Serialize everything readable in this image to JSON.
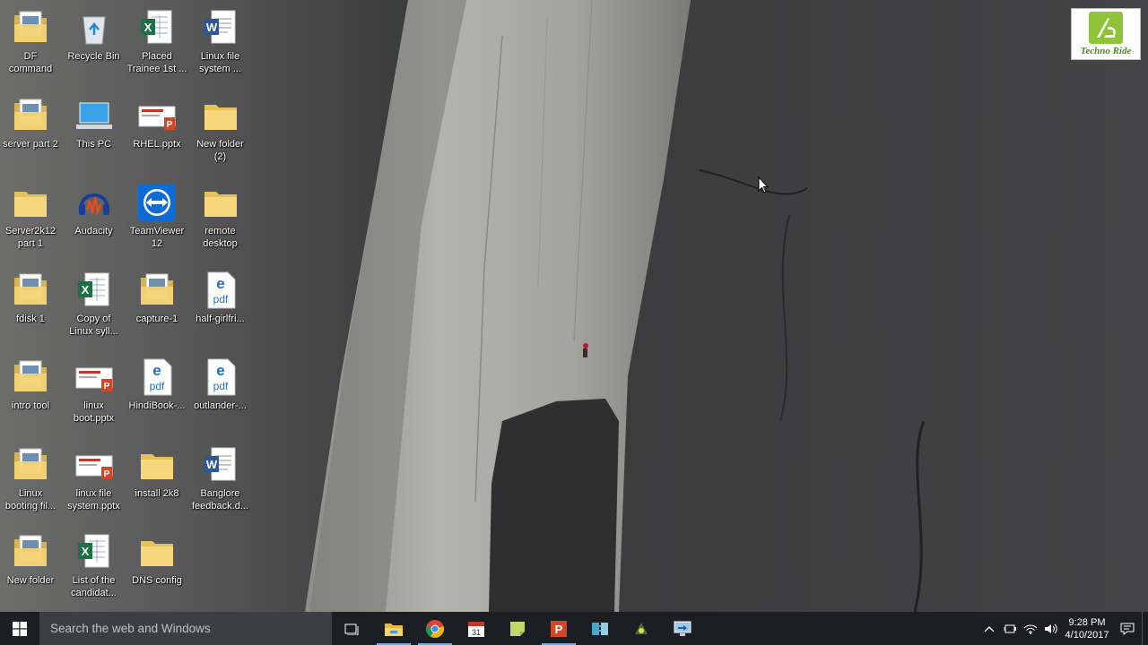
{
  "desktop": {
    "icons": [
      {
        "label": "DF\ncommand",
        "type": "folder-doc-icon"
      },
      {
        "label": "Recycle Bin",
        "type": "recycle-bin-icon"
      },
      {
        "label": "Placed\nTrainee 1st ...",
        "type": "excel-icon"
      },
      {
        "label": "Linux file\nsystem ...",
        "type": "word-icon"
      },
      {
        "label": "server part 2",
        "type": "folder-doc-icon"
      },
      {
        "label": "This PC",
        "type": "computer-icon"
      },
      {
        "label": "RHEL.pptx",
        "type": "powerpoint-icon"
      },
      {
        "label": "New folder\n(2)",
        "type": "folder-icon"
      },
      {
        "label": "Server2k12\npart 1",
        "type": "folder-icon"
      },
      {
        "label": "Audacity",
        "type": "audacity-icon"
      },
      {
        "label": "TeamViewer\n12",
        "type": "teamviewer-icon"
      },
      {
        "label": "remote\ndesktop",
        "type": "folder-icon"
      },
      {
        "label": "fdisk 1",
        "type": "folder-doc-icon"
      },
      {
        "label": "Copy of\nLinux syll...",
        "type": "excel-icon"
      },
      {
        "label": "capture-1",
        "type": "folder-doc-icon"
      },
      {
        "label": "half-girlfri...",
        "type": "edge-pdf-icon"
      },
      {
        "label": "intro tool",
        "type": "folder-doc-icon"
      },
      {
        "label": "linux\nboot.pptx",
        "type": "powerpoint-icon"
      },
      {
        "label": "HindiBook-...",
        "type": "edge-pdf-icon"
      },
      {
        "label": "outlander-...",
        "type": "edge-pdf-icon"
      },
      {
        "label": "Linux\nbooting fil...",
        "type": "folder-doc-icon"
      },
      {
        "label": "linux file\nsystem.pptx",
        "type": "powerpoint-icon"
      },
      {
        "label": "install 2k8",
        "type": "folder-icon"
      },
      {
        "label": "Banglore\nfeedback.d...",
        "type": "word-icon"
      },
      {
        "label": "New folder",
        "type": "folder-doc-icon"
      },
      {
        "label": "List of the\ncandidat...",
        "type": "excel-icon"
      },
      {
        "label": "DNS config",
        "type": "folder-icon"
      }
    ]
  },
  "watermark": {
    "text": "Techno Ride"
  },
  "taskbar": {
    "search_placeholder": "Search the web and Windows",
    "apps": [
      {
        "name": "task-view-icon",
        "open": false
      },
      {
        "name": "file-explorer-icon",
        "open": true
      },
      {
        "name": "chrome-icon",
        "open": true
      },
      {
        "name": "calendar-icon",
        "open": false
      },
      {
        "name": "sticky-notes-icon",
        "open": false
      },
      {
        "name": "powerpoint-icon",
        "open": true
      },
      {
        "name": "network-tool-icon",
        "open": false
      },
      {
        "name": "media-icon",
        "open": false
      },
      {
        "name": "remote-desktop-icon",
        "open": false
      }
    ],
    "tray": [
      "chevron-up-icon",
      "power-icon",
      "wifi-icon",
      "volume-icon"
    ],
    "clock": {
      "time": "9:28 PM",
      "date": "4/10/2017"
    }
  },
  "colors": {
    "taskbar": "#1b1e22",
    "search": "#3b3e43",
    "accent": "#7aa6d6"
  }
}
